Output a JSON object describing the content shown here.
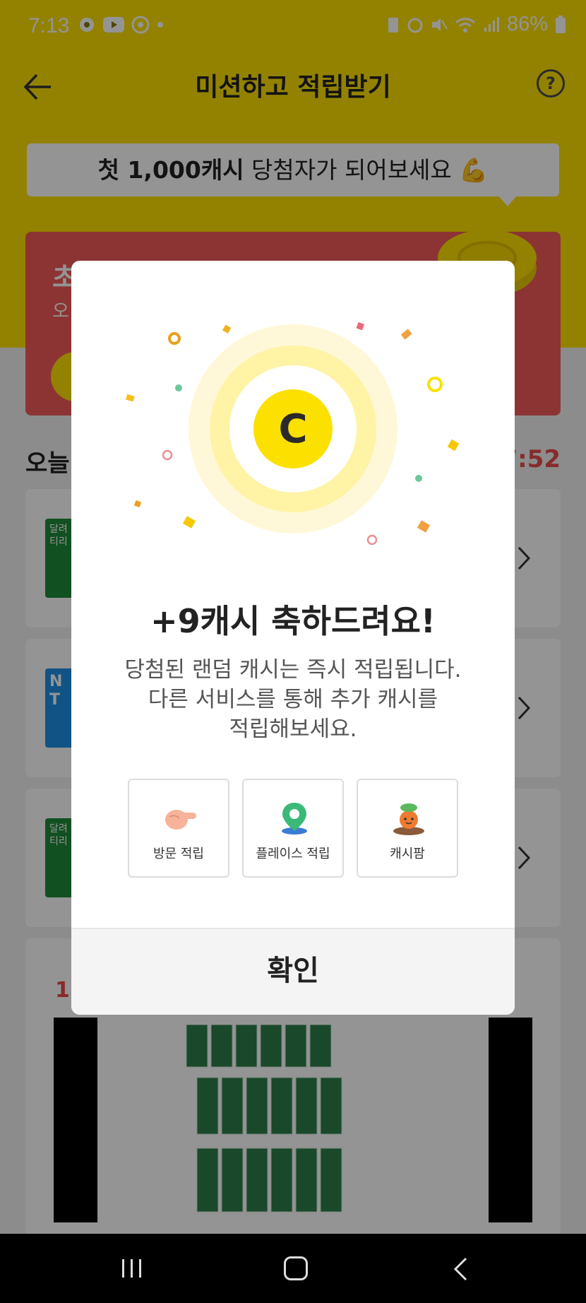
{
  "status_bar": {
    "time": "7:13",
    "battery": "86%"
  },
  "header": {
    "title": "미션하고 적립받기",
    "help_symbol": "?"
  },
  "banner": {
    "highlight": "첫 1,000캐시",
    "rest": " 당첨자가 되어보세요 💪"
  },
  "red_card": {
    "title_partial": "초",
    "subtitle_partial": "오"
  },
  "section": {
    "title_partial": "오늘",
    "timer_partial": "7:52"
  },
  "list_cards": [
    {
      "thumb_text": "달려\n티리",
      "thumb_color": "#1e8a3a"
    },
    {
      "thumb_text": "N\nT",
      "thumb_color": "#1e8fe6"
    },
    {
      "thumb_text": "달려\n티리",
      "thumb_color": "#1e8a3a"
    }
  ],
  "promo": {
    "label_partial": "11"
  },
  "modal": {
    "title": "+9캐시 축하드려요!",
    "description_lines": [
      "당첨된 랜덤 캐시는 즉시 적립됩니다.",
      "다른 서비스를 통해 추가 캐시를",
      "적립해보세요."
    ],
    "coin_symbol": "C",
    "services": [
      {
        "label": "방문 적립",
        "icon": "pointing-hand-icon"
      },
      {
        "label": "플레이스 적립",
        "icon": "map-pin-icon"
      },
      {
        "label": "캐시팜",
        "icon": "carrot-character-icon"
      }
    ],
    "confirm_label": "확인"
  },
  "colors": {
    "brand_yellow": "#fbe000",
    "red": "#f25a5a",
    "accent_red_text": "#e94a4a"
  }
}
